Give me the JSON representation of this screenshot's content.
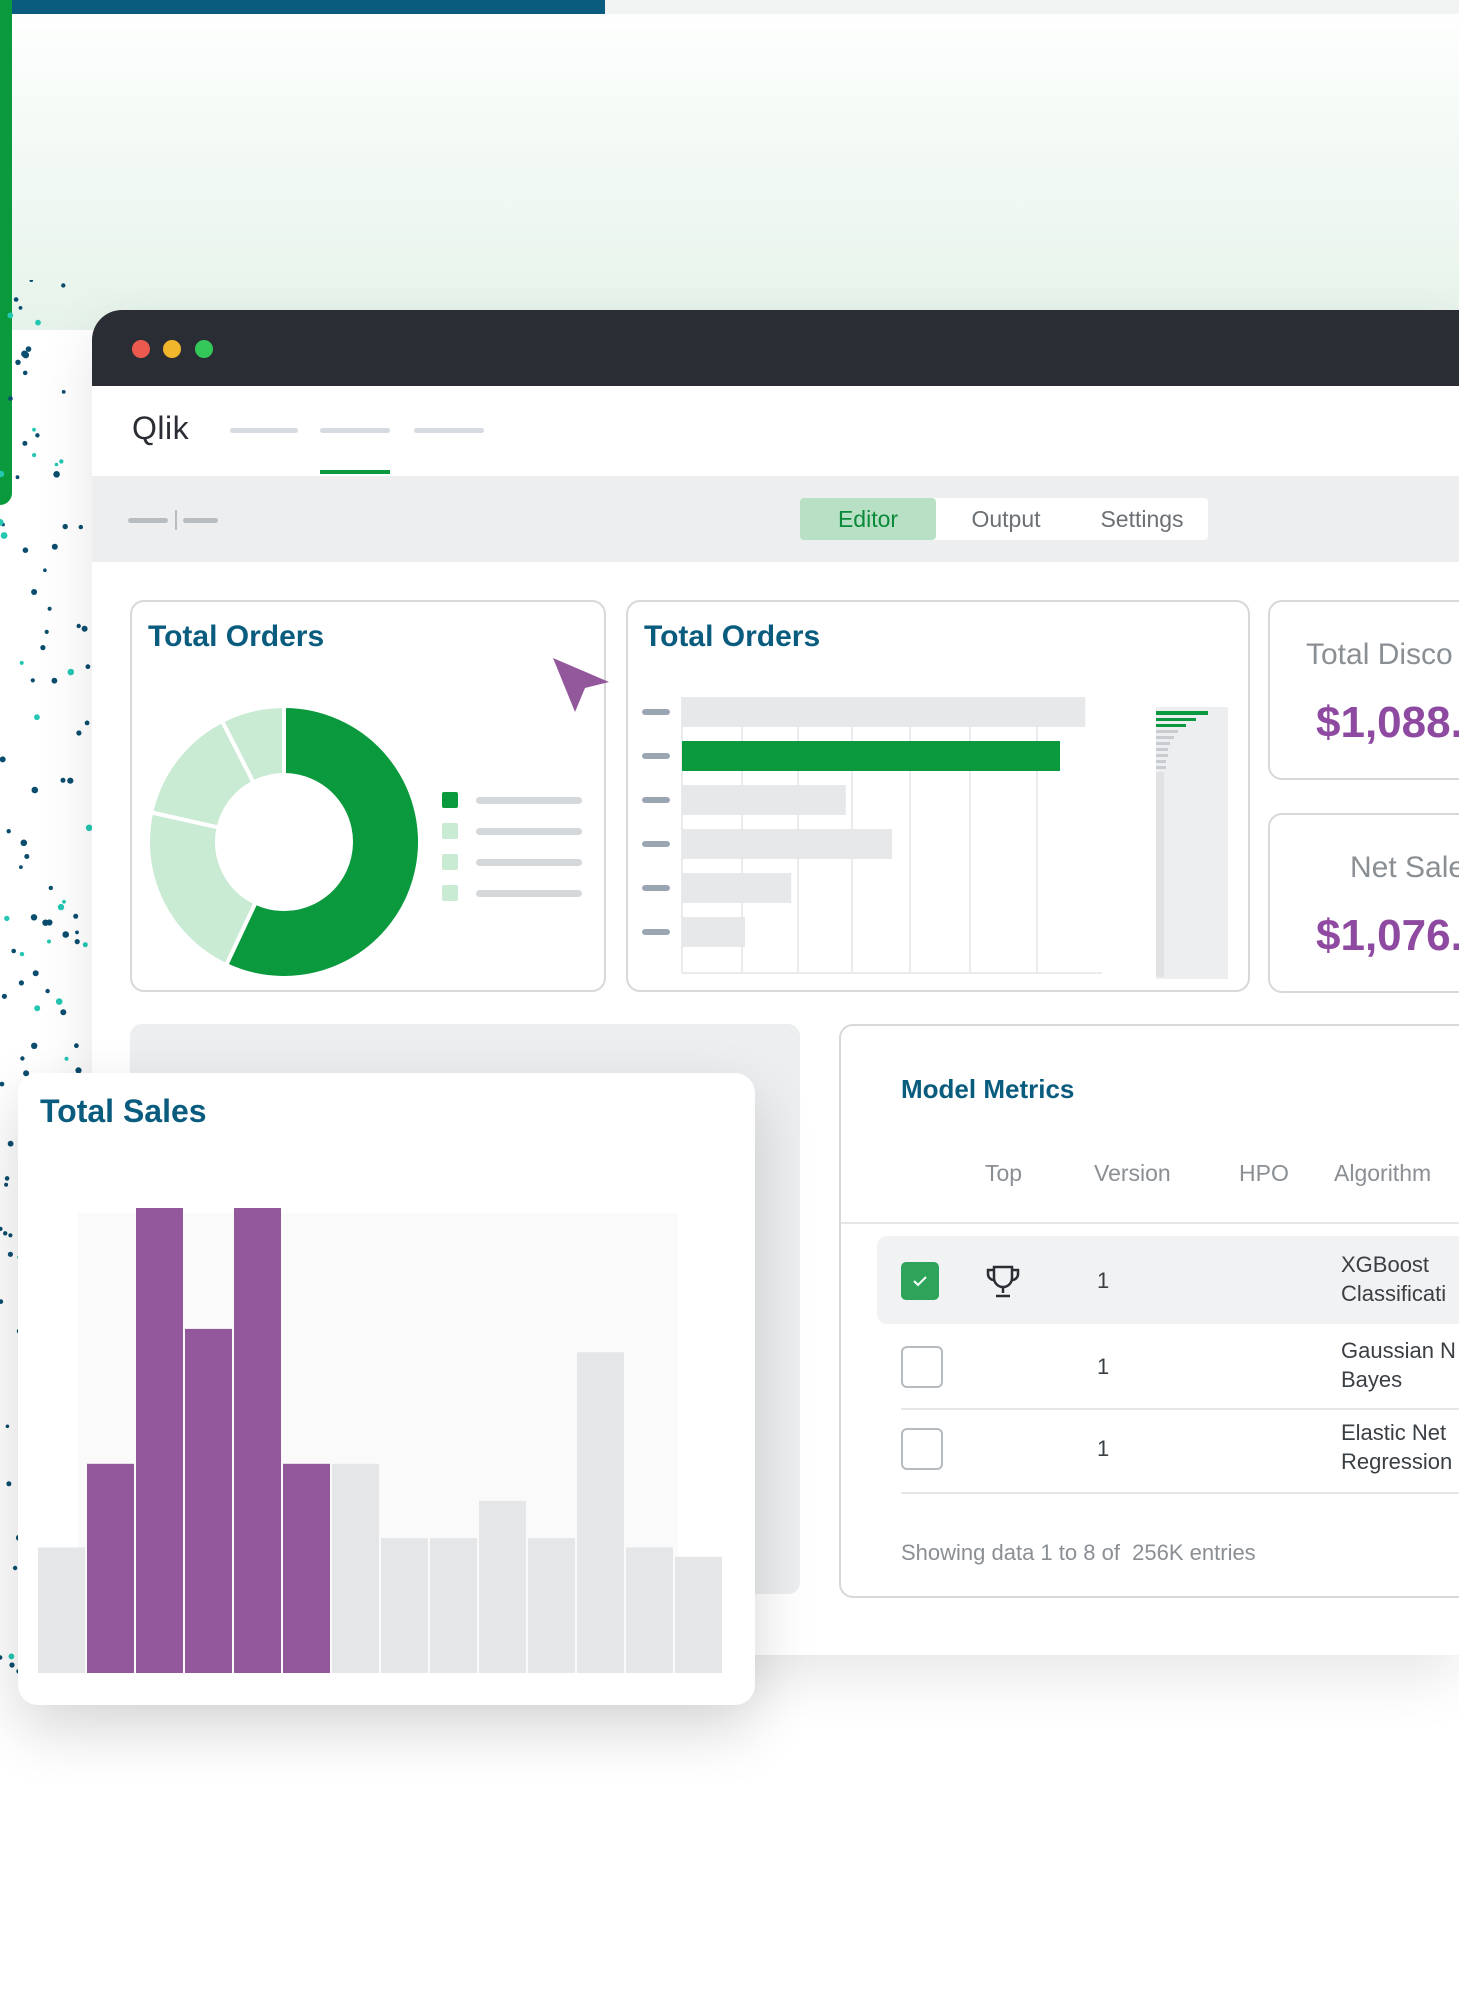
{
  "app": {
    "logo": "Qlik",
    "toolbar_tabs": [
      "Editor",
      "Output",
      "Settings"
    ]
  },
  "donut_card": {
    "title": "Total Orders",
    "chart_data": {
      "type": "pie",
      "slices": [
        {
          "value": 53,
          "color": "#0a9a3d"
        },
        {
          "value": 20,
          "color": "#c9ead3"
        },
        {
          "value": 13,
          "color": "#c9ead3"
        },
        {
          "value": 7,
          "color": "#c9ead3"
        }
      ],
      "legend_colors": [
        "#0a9a3d",
        "#c9ead3",
        "#c9ead3",
        "#c9ead3"
      ]
    }
  },
  "bar_card": {
    "title": "Total Orders",
    "chart_data": {
      "type": "bar",
      "orientation": "horizontal",
      "values": [
        96,
        90,
        39,
        50,
        26,
        15
      ],
      "highlight_index": 1,
      "highlight_color": "#0a9a3d",
      "base_color": "#e6e8ea",
      "xlim": [
        0,
        100
      ]
    }
  },
  "kpis": [
    {
      "label": "Total Disco",
      "value": "$1,088."
    },
    {
      "label": "Net Sale",
      "value": "$1,076."
    }
  ],
  "metrics": {
    "title": "Model Metrics",
    "columns": [
      "Top",
      "Version",
      "HPO",
      "Algorithm"
    ],
    "rows": [
      {
        "checked": true,
        "top": true,
        "version": "1",
        "algorithm_line1": "XGBoost",
        "algorithm_line2": "Classificati"
      },
      {
        "checked": false,
        "top": false,
        "version": "1",
        "algorithm_line1": "Gaussian N",
        "algorithm_line2": "Bayes"
      },
      {
        "checked": false,
        "top": false,
        "version": "1",
        "algorithm_line1": "Elastic Net",
        "algorithm_line2": "Regression"
      }
    ],
    "footer": "Showing data 1 to 8 of  256K entries"
  },
  "total_sales": {
    "title": "Total Sales",
    "chart_data": {
      "type": "bar",
      "values": [
        27,
        45,
        100,
        74,
        100,
        45,
        45,
        29,
        29,
        37,
        29,
        69,
        27,
        25
      ],
      "highlighted": [
        false,
        true,
        true,
        true,
        true,
        true,
        false,
        false,
        false,
        false,
        false,
        false,
        false,
        false
      ],
      "highlight_color": "#93589c",
      "base_color": "#e4e6e8",
      "ylim": [
        0,
        100
      ]
    }
  },
  "colors": {
    "brand_green": "#0a9a3d",
    "teal_title": "#0a5c7e",
    "purple": "#8e4aa0"
  }
}
